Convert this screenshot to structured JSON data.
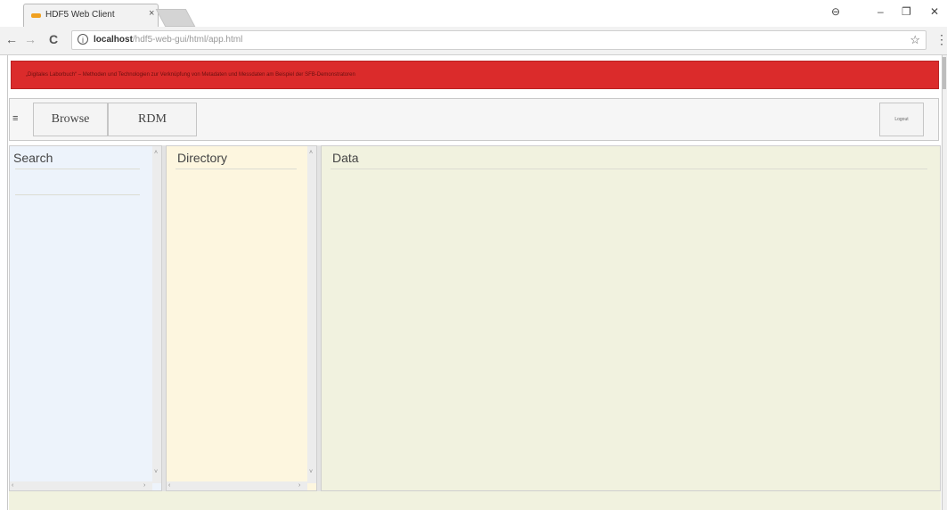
{
  "browser": {
    "tab_title": "HDF5 Web Client",
    "tab_close": "×",
    "url_host": "localhost",
    "url_path": "/hdf5-web-gui/html/app.html",
    "back": "←",
    "forward": "→",
    "reload": "C",
    "info": "i",
    "star": "☆",
    "menu": "⋮",
    "account": "⊖",
    "minimize": "–",
    "restore": "❐",
    "close": "✕"
  },
  "app": {
    "banner_text": "„Digitales Laborbuch“ – Methoden und Technologien zur Verknüpfung von Metadaten und Messdaten am Beispiel der SFB-Demonstratoren",
    "menu_icon": "≡",
    "nav_buttons": [
      "Browse",
      "RDM"
    ],
    "logout_label": "Logout",
    "panels": {
      "search": "Search",
      "directory": "Directory",
      "data": "Data"
    }
  },
  "colors": {
    "banner": "#db2b2b",
    "search_bg": "#edf3fb",
    "directory_bg": "#fdf6df",
    "data_bg": "#f1f2df"
  }
}
